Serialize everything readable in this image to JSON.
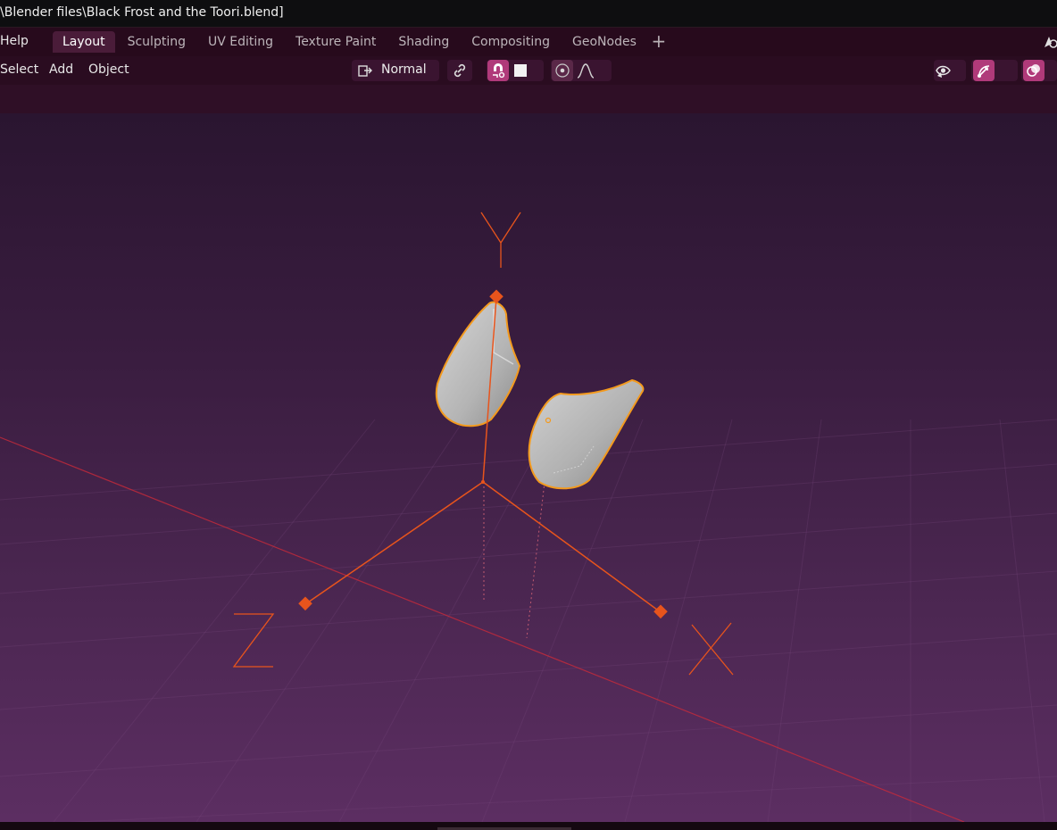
{
  "window": {
    "title": "\\Blender files\\Black Frost and the Toori.blend]"
  },
  "menubar": {
    "help_label": "Help",
    "tabs": [
      {
        "label": "Layout",
        "active": true
      },
      {
        "label": "Sculpting",
        "active": false
      },
      {
        "label": "UV Editing",
        "active": false
      },
      {
        "label": "Texture Paint",
        "active": false
      },
      {
        "label": "Shading",
        "active": false
      },
      {
        "label": "Compositing",
        "active": false
      },
      {
        "label": "GeoNodes",
        "active": false
      }
    ],
    "add_tab_icon": "plus-icon",
    "right_icon": "scene-icon"
  },
  "header": {
    "menus": [
      "Select",
      "Add",
      "Object"
    ],
    "transform_orientation": "Normal",
    "icons": {
      "orientation": "transform-orientation-icon",
      "pivot": "link-icon",
      "snap": "snap-magnet-icon",
      "snap_target": "square-icon",
      "proportional": "proportional-edit-icon",
      "falloff": "falloff-curve-icon",
      "visibility": "eye-icon",
      "gizmo": "gizmo-icon",
      "overlay": "overlay-icon"
    }
  },
  "viewport": {
    "axes": {
      "x": "X",
      "y": "Y",
      "z": "Z"
    },
    "colors": {
      "accent": "#4a1c39",
      "pink_button": "#b03a7a",
      "gizmo": "#e8541c",
      "selection_outline": "#f39a1e",
      "mesh": "#b8b8b8",
      "x_axis_line": "#c82a3a"
    }
  }
}
